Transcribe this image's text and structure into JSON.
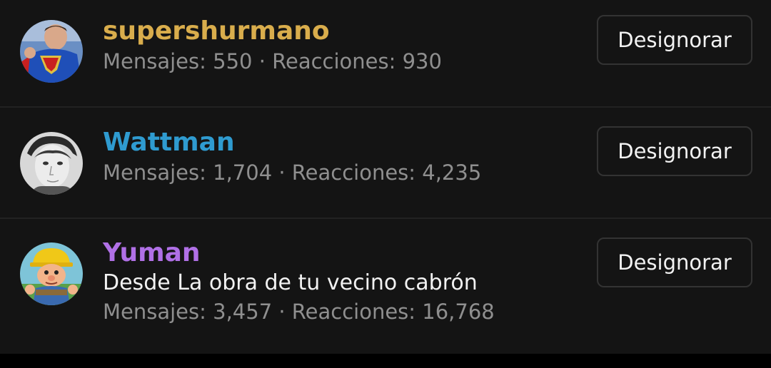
{
  "colors": {
    "background": "#141414",
    "divider": "#222222",
    "stats_text": "#8f8f8f"
  },
  "users": [
    {
      "name": "supershurmano",
      "name_color": "#d9ad4c",
      "tagline": "",
      "stats": "Mensajes: 550 · Reacciones: 930",
      "button_label": "Designorar",
      "avatar_icon": "superman-avatar"
    },
    {
      "name": "Wattman",
      "name_color": "#2f9bd0",
      "tagline": "",
      "stats": "Mensajes: 1,704 · Reacciones: 4,235",
      "button_label": "Designorar",
      "avatar_icon": "portrait-avatar"
    },
    {
      "name": "Yuman",
      "name_color": "#b070e6",
      "tagline": "Desde La obra de tu vecino cabrón",
      "stats": "Mensajes: 3,457 · Reacciones: 16,768",
      "button_label": "Designorar",
      "avatar_icon": "builder-avatar"
    }
  ]
}
